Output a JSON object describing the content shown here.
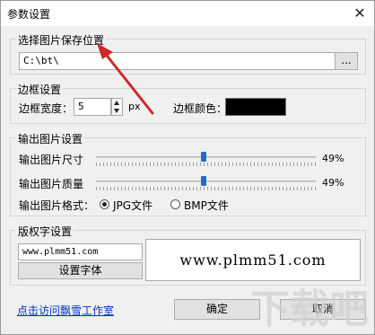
{
  "window": {
    "title": "参数设置",
    "close_glyph": "✕"
  },
  "save_group": {
    "legend": "选择图片保存位置",
    "path_value": "C:\\bt\\",
    "browse_label": "..."
  },
  "border_group": {
    "legend": "边框设置",
    "width_label": "边框宽度：",
    "width_value": "5",
    "unit": "px",
    "color_label": "边框颜色：",
    "color_value": "#000000"
  },
  "output_group": {
    "legend": "输出图片设置",
    "size_label": "输出图片尺寸",
    "size_percent": "49%",
    "size_level": 0.49,
    "quality_label": "输出图片质量",
    "quality_percent": "49%",
    "quality_level": 0.49,
    "format_label": "输出图片格式：",
    "format_jpg": "JPG文件",
    "format_bmp": "BMP文件",
    "format_selected": "JPG文件"
  },
  "watermark_group": {
    "legend": "版权字设置",
    "text_value": "www.plmm51.com",
    "font_button": "设置字体",
    "preview_text": "www.plmm51.com"
  },
  "footer": {
    "link": "点击访问飘雪工作室",
    "ok": "确定",
    "cancel": "取消"
  },
  "overlay": {
    "watermark_text": "下载吧"
  },
  "colors": {
    "arrow": "#d0272b",
    "accent": "#1e6ec8"
  }
}
